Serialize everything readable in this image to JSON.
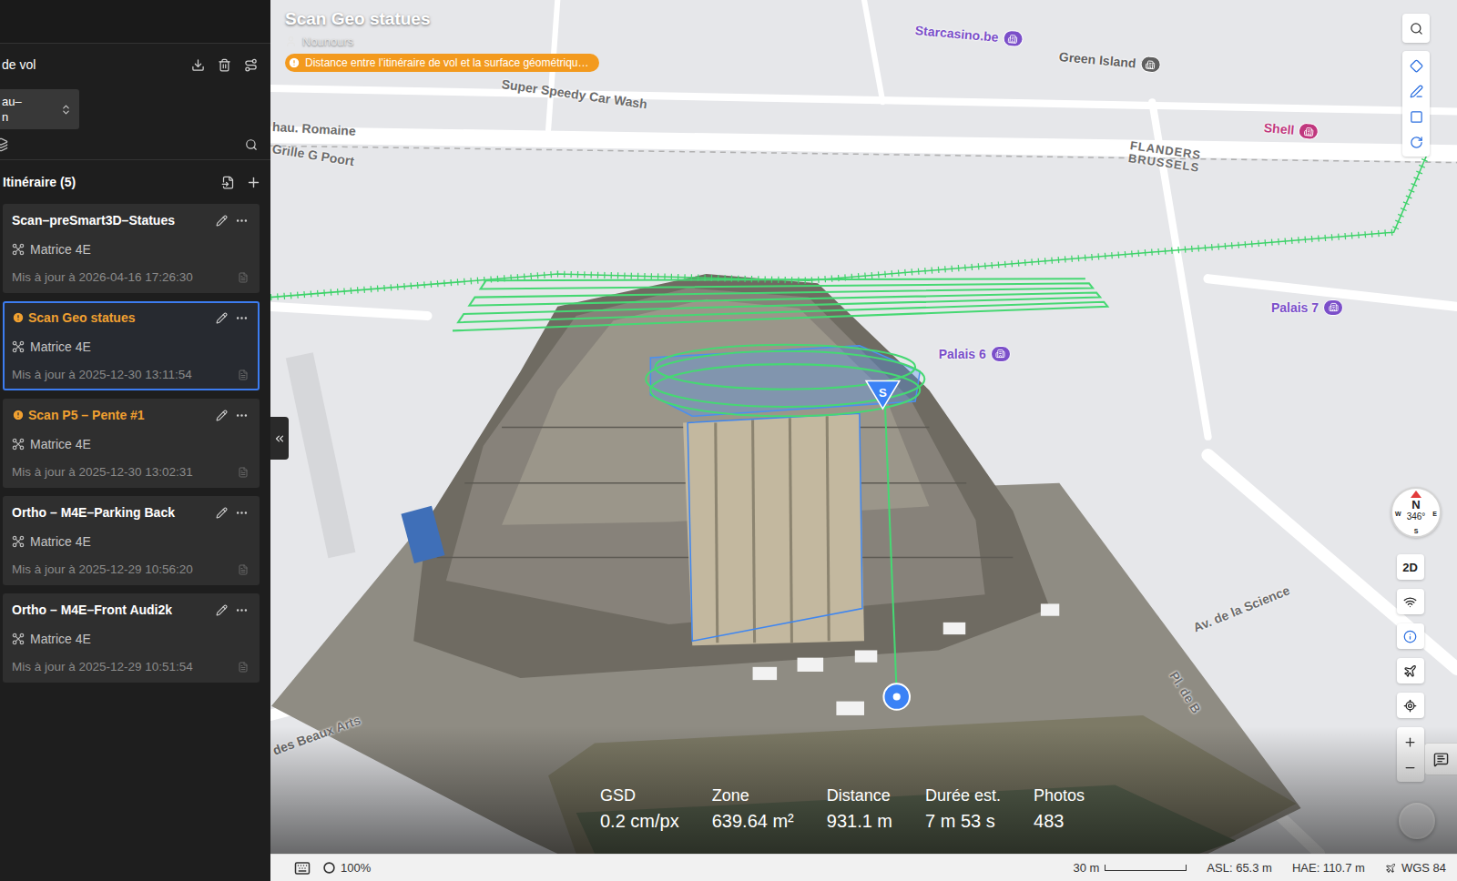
{
  "window": {
    "title": "Scan Geo statues",
    "owner": "Nounours",
    "warning": "Distance entre l’itinéraire de vol et la surface géométriqu…"
  },
  "sidebar": {
    "header": "de vol",
    "dropdown": [
      "au–",
      "n"
    ],
    "section": "Itinéraire (5)",
    "routes": [
      {
        "name": "Scan–preSmart3D–Statues",
        "warning": false,
        "drone": "Matrice 4E",
        "updated": "Mis à jour à 2026-04-16 17:26:30",
        "selected": false
      },
      {
        "name": "Scan Geo statues",
        "warning": true,
        "drone": "Matrice 4E",
        "updated": "Mis à jour à 2025-12-30 13:11:54",
        "selected": true
      },
      {
        "name": "Scan P5 – Pente #1",
        "warning": true,
        "drone": "Matrice 4E",
        "updated": "Mis à jour à 2025-12-30 13:02:31",
        "selected": false
      },
      {
        "name": "Ortho – M4E–Parking Back",
        "warning": false,
        "drone": "Matrice 4E",
        "updated": "Mis à jour à 2025-12-29 10:56:20",
        "selected": false
      },
      {
        "name": "Ortho – M4E–Front Audi2k",
        "warning": false,
        "drone": "Matrice 4E",
        "updated": "Mis à jour à 2025-12-29 10:51:54",
        "selected": false
      }
    ]
  },
  "map": {
    "start_marker": "S",
    "labels": [
      {
        "kind": "street",
        "text": "Super Speedy Car Wash"
      },
      {
        "kind": "street",
        "text": "hau. Romaine"
      },
      {
        "kind": "street",
        "text": "Grille G Poort"
      },
      {
        "kind": "poi",
        "text": "Starcasino.be",
        "color": "#7b4fc9"
      },
      {
        "kind": "poi",
        "text": "Green Island",
        "color": "#5f5f5f"
      },
      {
        "kind": "poi",
        "text": "Shell",
        "color": "#c0377e"
      },
      {
        "kind": "district",
        "text": "FLANDERS BRUSSELS"
      },
      {
        "kind": "poi",
        "text": "Palais 7",
        "color": "#7b4fc9"
      },
      {
        "kind": "poi",
        "text": "Palais 6",
        "color": "#7b4fc9"
      },
      {
        "kind": "street",
        "text": "Av. de la Science"
      },
      {
        "kind": "street",
        "text": "Pl. de B"
      },
      {
        "kind": "street",
        "text": "des Beaux Arts"
      }
    ]
  },
  "compass": {
    "north": "N",
    "heading": "346°",
    "east": "E",
    "south": "S",
    "west": "W"
  },
  "view_toggle": "2D",
  "stats": [
    {
      "label": "GSD",
      "value": "0.2 cm/px"
    },
    {
      "label": "Zone",
      "value": "639.64 m²"
    },
    {
      "label": "Distance",
      "value": "931.1 m"
    },
    {
      "label": "Durée est.",
      "value": "7 m 53 s"
    },
    {
      "label": "Photos",
      "value": "483"
    }
  ],
  "status_bar": {
    "zoom": "100%",
    "scale": "30 m",
    "asl": "ASL: 65.3 m",
    "hae": "HAE: 110.7 m",
    "datum": "WGS 84"
  }
}
